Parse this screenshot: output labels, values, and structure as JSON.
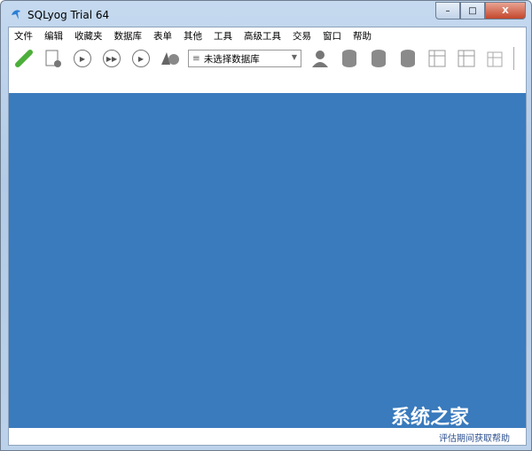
{
  "window": {
    "title": "SQLyog Trial 64",
    "minimize": "–",
    "maximize": "□",
    "close": "X"
  },
  "menu": [
    "文件",
    "编辑",
    "收藏夹",
    "数据库",
    "表单",
    "其他",
    "工具",
    "高级工具",
    "交易",
    "窗口",
    "帮助"
  ],
  "toolbar": {
    "db_select": "未选择数据库"
  },
  "status": {
    "text": "评估期间获取帮助"
  },
  "watermark": "系统之家",
  "colors": {
    "workspace": "#3a7bbd",
    "connect": "#4caf3a"
  }
}
